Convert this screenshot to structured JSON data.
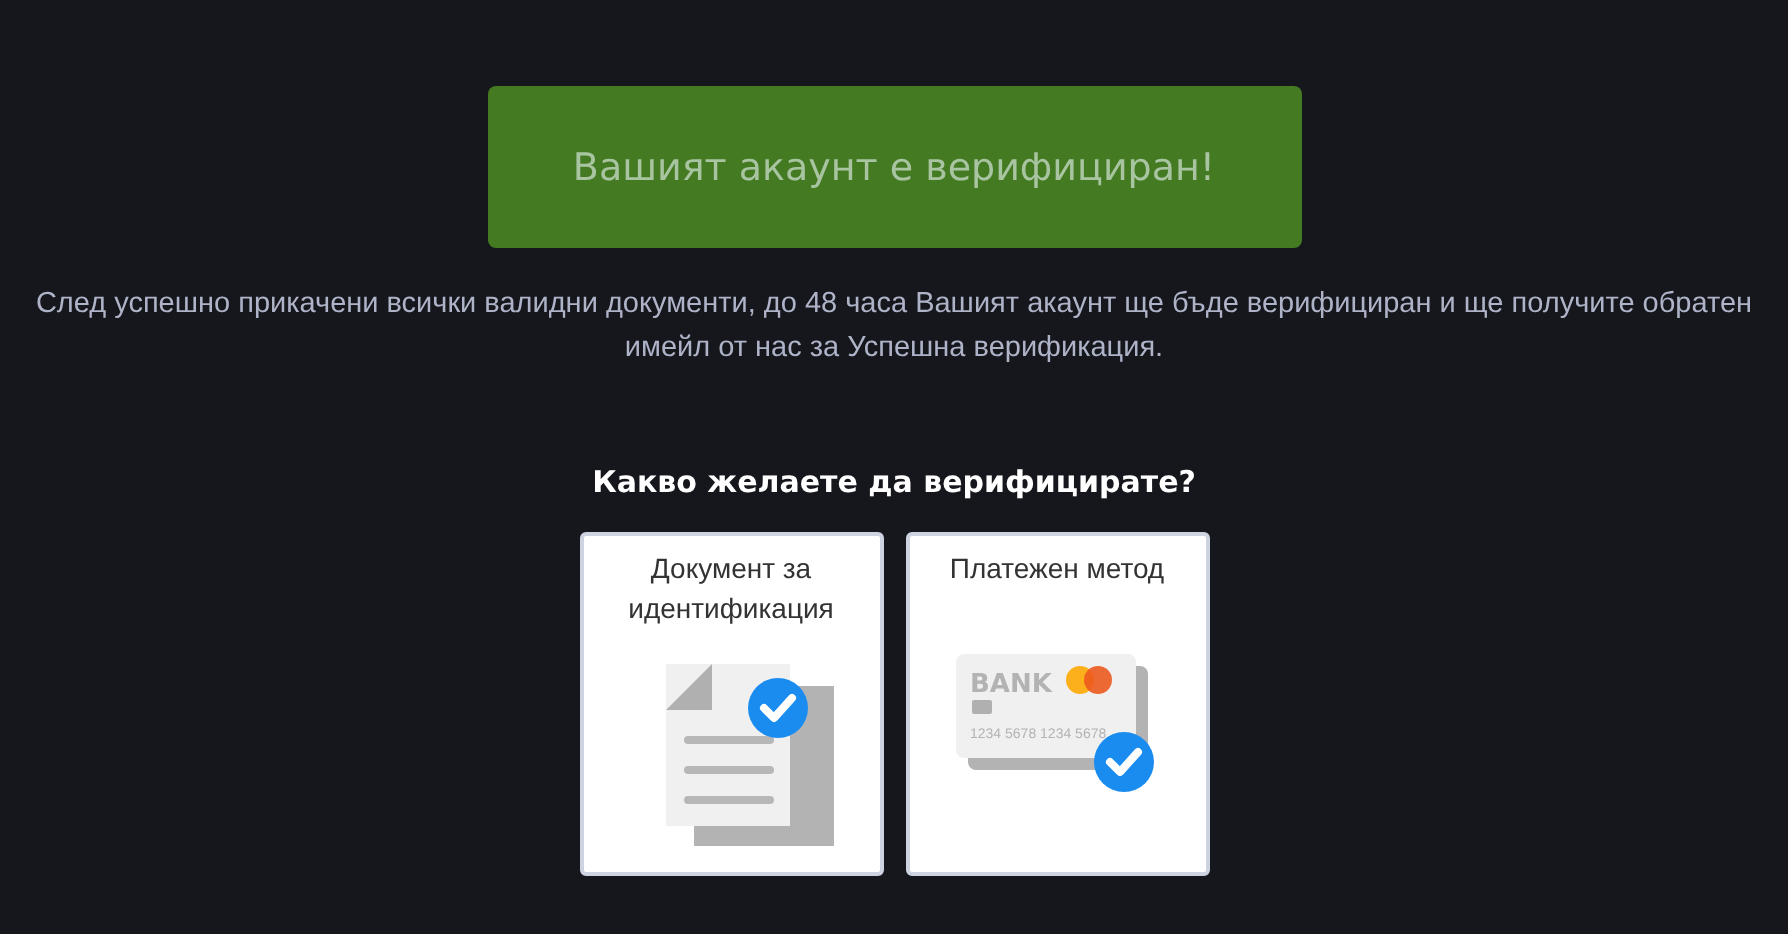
{
  "banner": {
    "text": "Вашият акаунт е верифициран!"
  },
  "info": "След успешно прикачени всички валидни документи, до 48 часа Вашият акаунт ще бъде верифициран и ще получите обратен имейл от нас за Успешна верификация.",
  "question": "Какво желаете да верифицирате?",
  "options": [
    {
      "kind": "document",
      "label": "Документ за идентификация",
      "verified": true
    },
    {
      "kind": "card",
      "label": "Платежен метод",
      "verified": true,
      "bank": "BANK",
      "number": "1234 5678 1234 5678"
    }
  ]
}
